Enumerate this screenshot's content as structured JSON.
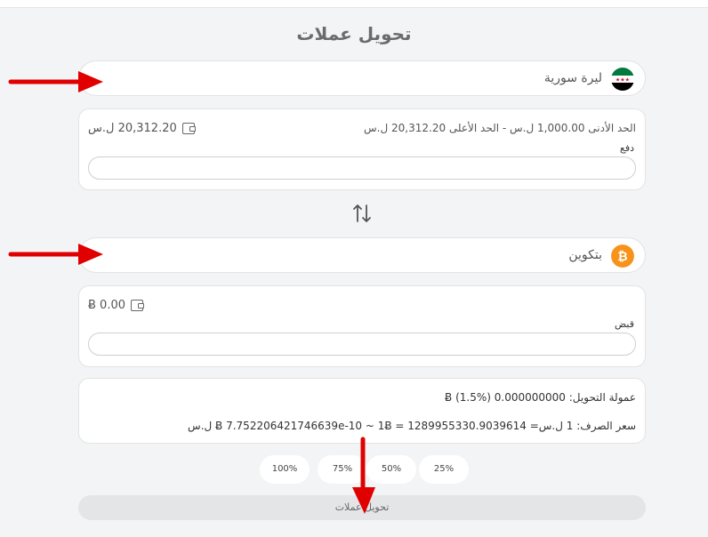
{
  "page": {
    "title": "تحويل عملات"
  },
  "from_currency": {
    "name": "ليرة سورية",
    "flag_icon": "syria-flag-icon",
    "balance": "20,312.20 ل.س",
    "limits": "الحد الأدنى 1,000.00 ل.س   -   الحد الأعلى 20,312.20 ل.س",
    "field_label": "دفع",
    "amount_value": ""
  },
  "swap_icon": "swap-vertical-icon",
  "to_currency": {
    "name": "بتكوين",
    "icon": "bitcoin-icon",
    "balance": "Ƀ 0.00",
    "field_label": "قبض",
    "amount_value": ""
  },
  "info": {
    "fee": "عمولة التحويل: 0.000000000 Ƀ (1.5%)",
    "rate": "سعر الصرف: 1 ل.س= Ƀ 7.75220642174663​9e-10 ~ 1Ƀ = 1289955330.9039614 ل.س"
  },
  "percent_buttons": [
    "100%",
    "75%",
    "50%",
    "25%"
  ],
  "submit": {
    "label": "تحويل عملات"
  },
  "colors": {
    "bitcoin": "#f7931a",
    "annotation_arrow": "#e00000"
  }
}
